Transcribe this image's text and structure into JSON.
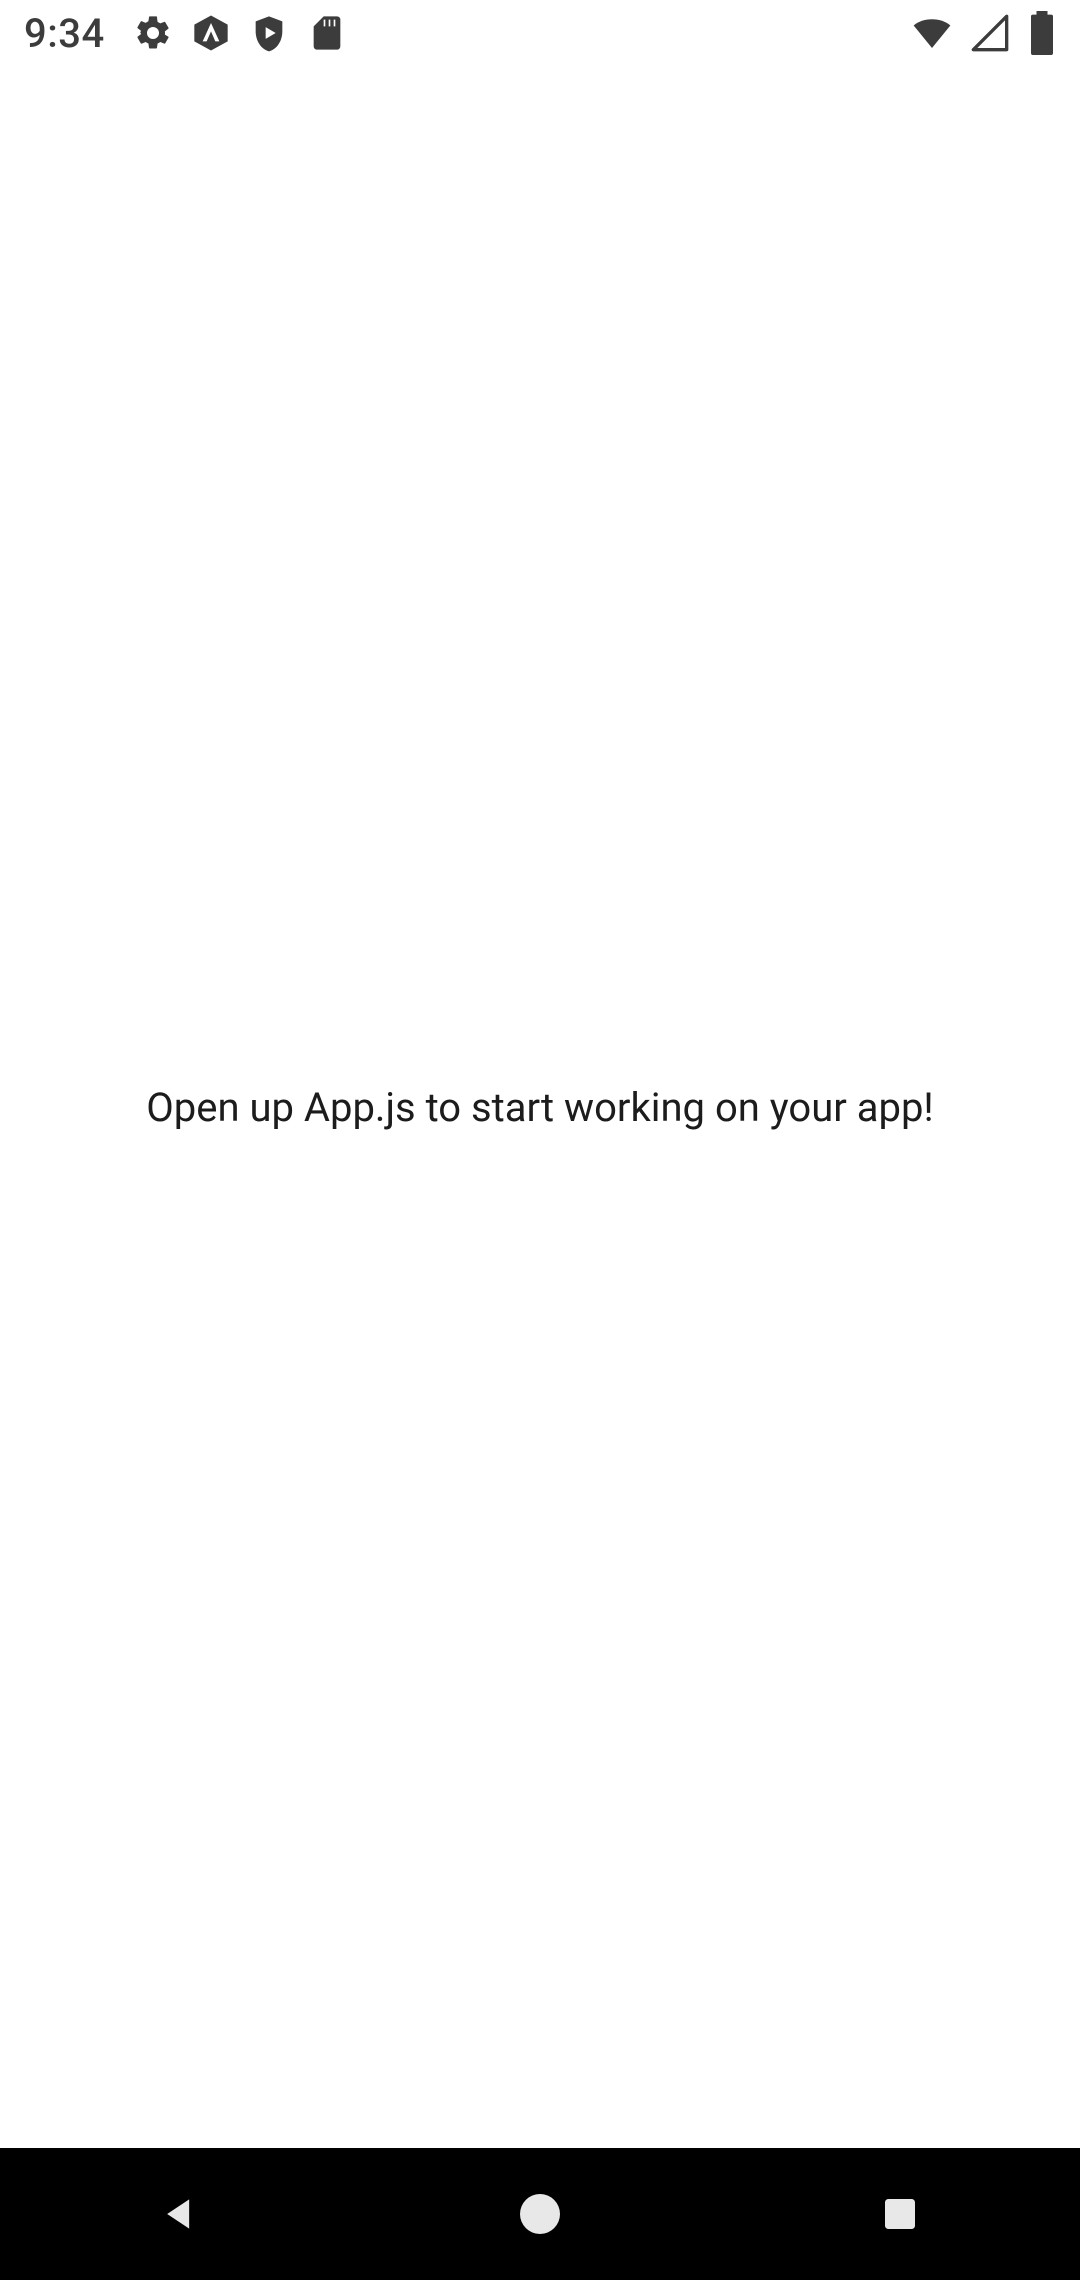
{
  "status": {
    "time": "9:34"
  },
  "content": {
    "message": "Open up App.js to start working on your app!"
  }
}
